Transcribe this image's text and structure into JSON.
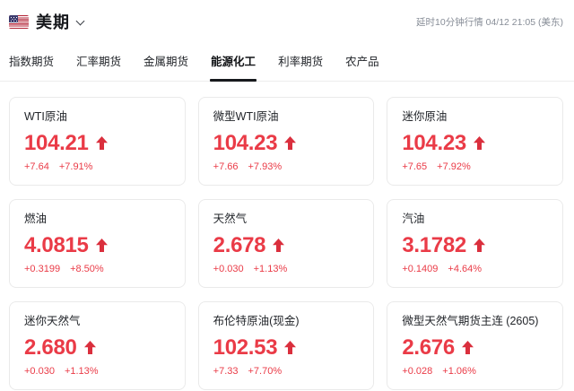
{
  "colors": {
    "up": "#ea3b47",
    "up-arrow": "#da2f3d",
    "tab-underline": "#17191d",
    "text-primary": "#22252a",
    "text-muted": "#878d97",
    "card-border": "#eaeaea"
  },
  "header": {
    "flag_icon": "us-flag-icon",
    "market_title": "美期",
    "chevron_icon": "chevron-down-icon",
    "delayed_quote_info": "延时10分钟行情 04/12 21:05 (美东)"
  },
  "tabs": [
    {
      "label": "指数期货",
      "active": false
    },
    {
      "label": "汇率期货",
      "active": false
    },
    {
      "label": "金属期货",
      "active": false
    },
    {
      "label": "能源化工",
      "active": true
    },
    {
      "label": "利率期货",
      "active": false
    },
    {
      "label": "农产品",
      "active": false
    }
  ],
  "cards": [
    {
      "name": "WTI原油",
      "price": "104.21",
      "change": "+7.64",
      "change_pct": "+7.91%",
      "direction": "up"
    },
    {
      "name": "微型WTI原油",
      "price": "104.23",
      "change": "+7.66",
      "change_pct": "+7.93%",
      "direction": "up"
    },
    {
      "name": "迷你原油",
      "price": "104.23",
      "change": "+7.65",
      "change_pct": "+7.92%",
      "direction": "up"
    },
    {
      "name": "燃油",
      "price": "4.0815",
      "change": "+0.3199",
      "change_pct": "+8.50%",
      "direction": "up"
    },
    {
      "name": "天然气",
      "price": "2.678",
      "change": "+0.030",
      "change_pct": "+1.13%",
      "direction": "up"
    },
    {
      "name": "汽油",
      "price": "3.1782",
      "change": "+0.1409",
      "change_pct": "+4.64%",
      "direction": "up"
    },
    {
      "name": "迷你天然气",
      "price": "2.680",
      "change": "+0.030",
      "change_pct": "+1.13%",
      "direction": "up"
    },
    {
      "name": "布伦特原油(现金)",
      "price": "102.53",
      "change": "+7.33",
      "change_pct": "+7.70%",
      "direction": "up"
    },
    {
      "name": "微型天然气期货主连 (2605)",
      "price": "2.676",
      "change": "+0.028",
      "change_pct": "+1.06%",
      "direction": "up"
    }
  ]
}
